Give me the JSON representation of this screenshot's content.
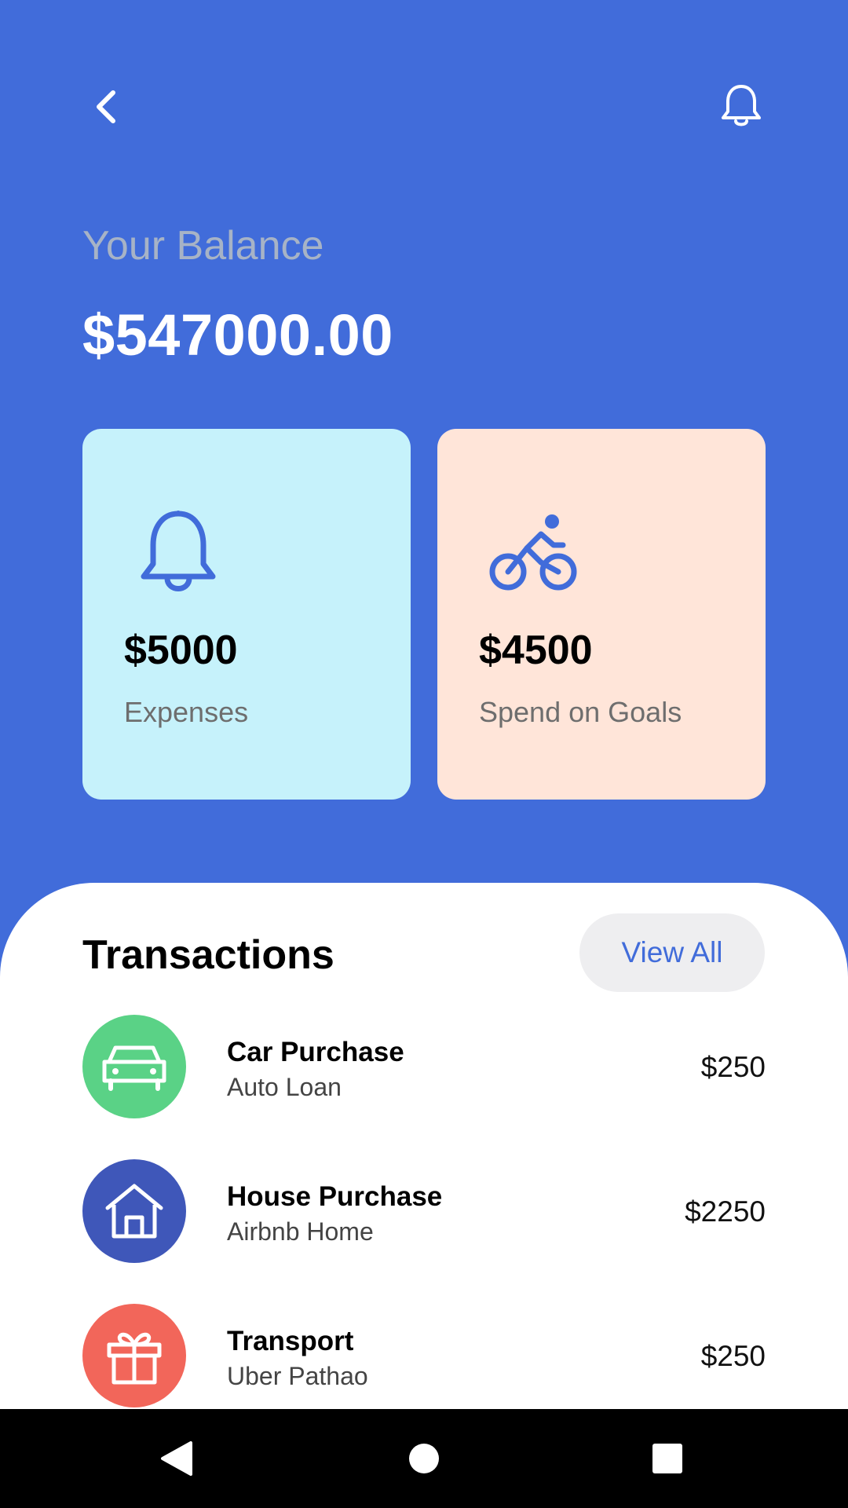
{
  "header": {
    "back_icon": "chevron-left-icon",
    "notification_icon": "bell-icon"
  },
  "balance": {
    "label": "Your Balance",
    "value": "$547000.00"
  },
  "cards": [
    {
      "amount": "$5000",
      "label": "Expenses",
      "icon": "bell-icon",
      "background": "#C6F2FB"
    },
    {
      "amount": "$4500",
      "label": "Spend on Goals",
      "icon": "bike-icon",
      "background": "#FFE5D9"
    }
  ],
  "transactions": {
    "title": "Transactions",
    "view_all_label": "View All",
    "items": [
      {
        "name": "Car Purchase",
        "subtitle": "Auto Loan",
        "amount": "$250",
        "icon": "car-icon",
        "color": "#5AD286"
      },
      {
        "name": "House Purchase",
        "subtitle": "Airbnb Home",
        "amount": "$2250",
        "icon": "home-icon",
        "color": "#3F57B9"
      },
      {
        "name": "Transport",
        "subtitle": "Uber Pathao",
        "amount": "$250",
        "icon": "gift-icon",
        "color": "#F2665A"
      }
    ]
  },
  "colors": {
    "primary": "#416CDA",
    "accent_text": "#416CDA"
  },
  "system_nav": {
    "back": "triangle-back-icon",
    "home": "circle-home-icon",
    "recents": "square-recents-icon"
  }
}
